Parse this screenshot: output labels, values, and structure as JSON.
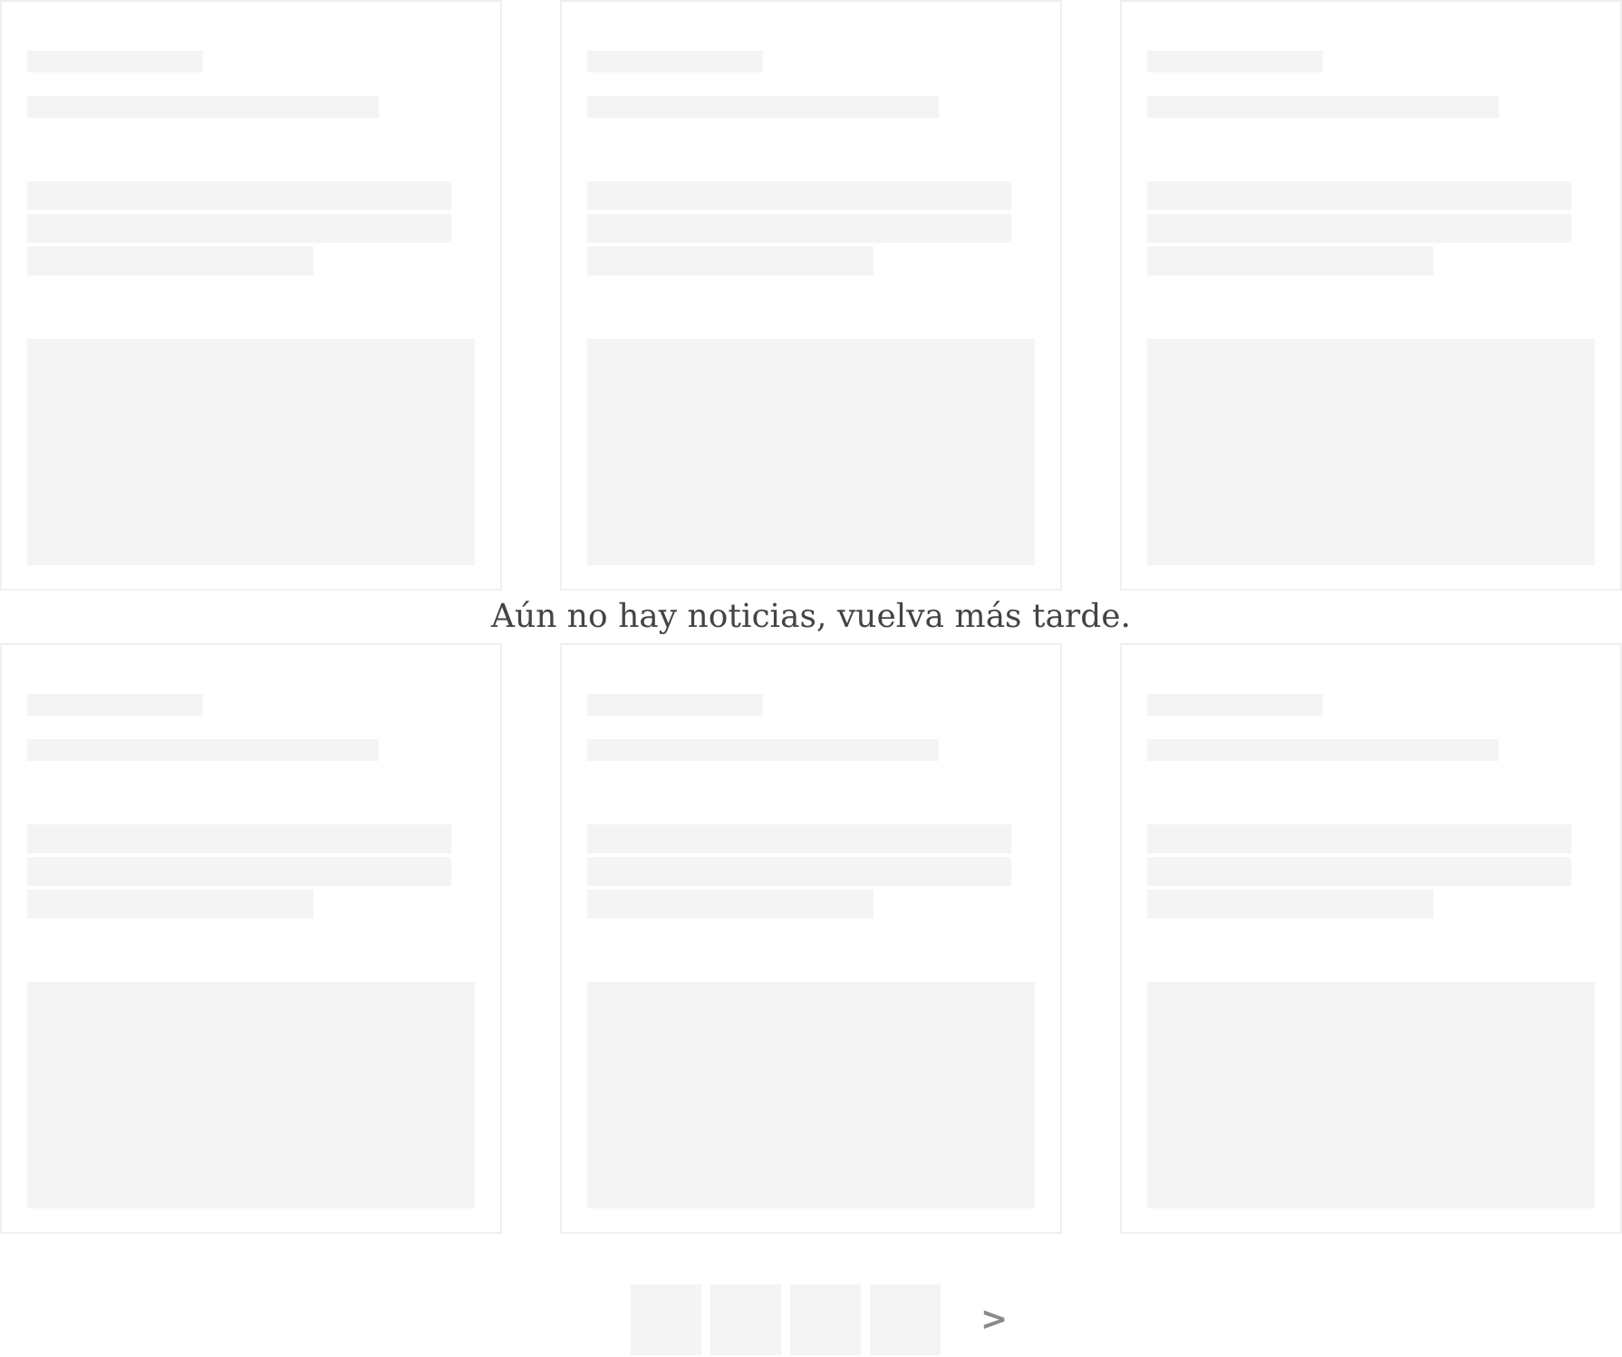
{
  "news_cards_top": [
    {
      "kind": "skeleton"
    },
    {
      "kind": "skeleton"
    },
    {
      "kind": "skeleton"
    }
  ],
  "empty_message": "Aún no hay noticias, vuelva más tarde.",
  "news_cards_bottom": [
    {
      "kind": "skeleton"
    },
    {
      "kind": "skeleton"
    },
    {
      "kind": "skeleton"
    }
  ],
  "pagination": {
    "pages": [
      {
        "kind": "skeleton"
      },
      {
        "kind": "skeleton"
      },
      {
        "kind": "skeleton"
      },
      {
        "kind": "skeleton"
      }
    ],
    "next": ">"
  }
}
